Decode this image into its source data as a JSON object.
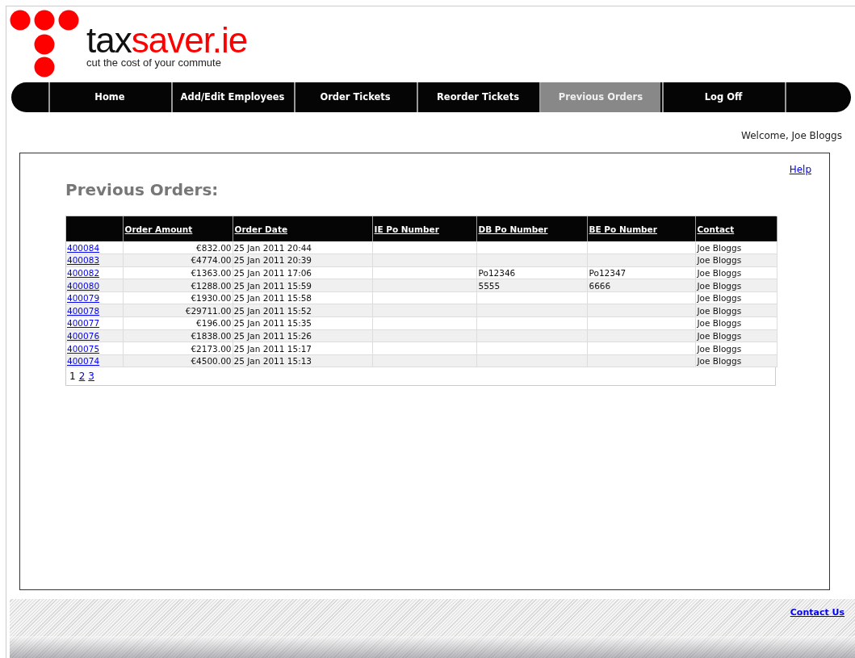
{
  "logo": {
    "name_dark": "tax",
    "name_accent": "saver.ie",
    "tagline": "cut the cost of your commute"
  },
  "nav": [
    {
      "label": "Home",
      "selected": false
    },
    {
      "label": "Add/Edit Employees",
      "selected": false
    },
    {
      "label": "Order Tickets",
      "selected": false
    },
    {
      "label": "Reorder Tickets",
      "selected": false
    },
    {
      "label": "Previous Orders",
      "selected": true
    },
    {
      "label": "Log Off",
      "selected": false
    }
  ],
  "welcome": "Welcome, Joe Bloggs",
  "help_link": "Help",
  "heading": "Previous Orders:",
  "table": {
    "columns": [
      "Order Amount",
      "Order Date",
      "IE Po Number",
      "DB Po Number",
      "BE Po Number",
      "Contact"
    ],
    "rows": [
      {
        "order": "400084",
        "amount": "€832.00",
        "date": "25 Jan 2011 20:44",
        "ie_po": "",
        "db_po": "",
        "be_po": "",
        "contact": "Joe Bloggs"
      },
      {
        "order": "400083",
        "amount": "€4774.00",
        "date": "25 Jan 2011 20:39",
        "ie_po": "",
        "db_po": "",
        "be_po": "",
        "contact": "Joe Bloggs"
      },
      {
        "order": "400082",
        "amount": "€1363.00",
        "date": "25 Jan 2011 17:06",
        "ie_po": "",
        "db_po": "Po12346",
        "be_po": "Po12347",
        "contact": "Joe Bloggs"
      },
      {
        "order": "400080",
        "amount": "€1288.00",
        "date": "25 Jan 2011 15:59",
        "ie_po": "",
        "db_po": "5555",
        "be_po": "6666",
        "contact": "Joe Bloggs"
      },
      {
        "order": "400079",
        "amount": "€1930.00",
        "date": "25 Jan 2011 15:58",
        "ie_po": "",
        "db_po": "",
        "be_po": "",
        "contact": "Joe Bloggs"
      },
      {
        "order": "400078",
        "amount": "€29711.00",
        "date": "25 Jan 2011 15:52",
        "ie_po": "",
        "db_po": "",
        "be_po": "",
        "contact": "Joe Bloggs"
      },
      {
        "order": "400077",
        "amount": "€196.00",
        "date": "25 Jan 2011 15:35",
        "ie_po": "",
        "db_po": "",
        "be_po": "",
        "contact": "Joe Bloggs"
      },
      {
        "order": "400076",
        "amount": "€1838.00",
        "date": "25 Jan 2011 15:26",
        "ie_po": "",
        "db_po": "",
        "be_po": "",
        "contact": "Joe Bloggs"
      },
      {
        "order": "400075",
        "amount": "€2173.00",
        "date": "25 Jan 2011 15:17",
        "ie_po": "",
        "db_po": "",
        "be_po": "",
        "contact": "Joe Bloggs"
      },
      {
        "order": "400074",
        "amount": "€4500.00",
        "date": "25 Jan 2011 15:13",
        "ie_po": "",
        "db_po": "",
        "be_po": "",
        "contact": "Joe Bloggs"
      }
    ]
  },
  "pages": [
    {
      "label": "1",
      "selected": true
    },
    {
      "label": "2",
      "selected": false
    },
    {
      "label": "3",
      "selected": false
    }
  ],
  "footer_link": "Contact Us"
}
